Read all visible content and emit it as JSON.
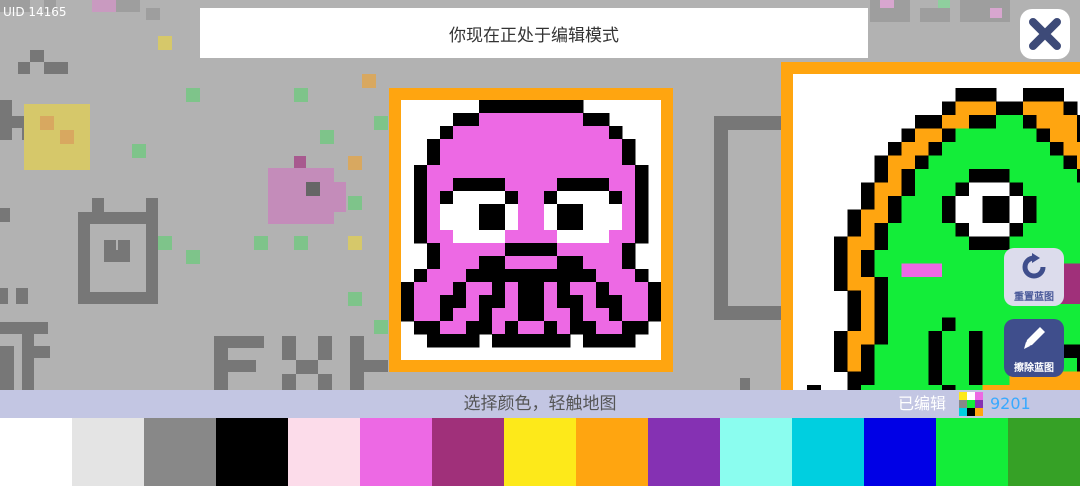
{
  "header": {
    "uid": "UID 14165",
    "banner_text": "你现在正处于编辑模式"
  },
  "icons": {
    "close": "close-x-icon",
    "reset": "rotate-arrow-icon",
    "erase": "pencil-icon"
  },
  "side_buttons": {
    "reset_label": "重置蓝图",
    "erase_label": "擦除蓝图"
  },
  "status": {
    "hint": "选择颜色，轻触地图",
    "edited_label": "已编辑",
    "edited_count": "9201"
  },
  "palette": [
    "#ffffff",
    "#e4e4e4",
    "#888888",
    "#000000",
    "#fcdcea",
    "#ed69e4",
    "#a0307a",
    "#fde91a",
    "#ffa510",
    "#8531b3",
    "#8bfdef",
    "#00cfe0",
    "#0000e6",
    "#13ed39",
    "#36a126"
  ],
  "colors": {
    "accent_border": "#ffa510",
    "status_bar": "#c3c6e3",
    "count_color": "#39a9ff",
    "map_background": "#b2b2b2"
  }
}
